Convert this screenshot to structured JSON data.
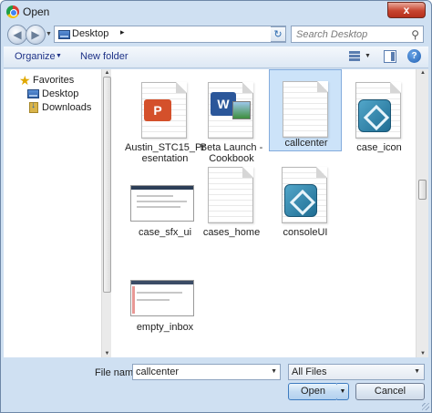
{
  "window": {
    "title": "Open",
    "close_label": "x"
  },
  "address": {
    "location": "Desktop",
    "separator": "▸"
  },
  "search": {
    "placeholder": "Search Desktop"
  },
  "toolbar": {
    "organize_label": "Organize",
    "new_folder_label": "New folder"
  },
  "navigation": {
    "items": [
      {
        "label": "Favorites",
        "icon": "star-icon"
      },
      {
        "label": "Desktop",
        "icon": "folder-icon"
      },
      {
        "label": "Downloads",
        "icon": "downloads-icon"
      }
    ]
  },
  "files": [
    {
      "name": "Austin_STC15_Presentation",
      "label_line1": "Austin_STC15_Pr",
      "label_line2": "esentation",
      "icon": "powerpoint-file-icon",
      "selected": false
    },
    {
      "name": "Beta Launch - Cookbook",
      "label_line1": "Beta Launch -",
      "label_line2": "Cookbook",
      "icon": "word-file-icon",
      "selected": false
    },
    {
      "name": "callcenter",
      "label_line1": "callcenter",
      "label_line2": "",
      "icon": "text-file-icon",
      "selected": true
    },
    {
      "name": "case_icon",
      "label_line1": "case_icon",
      "label_line2": "",
      "icon": "app-file-icon",
      "selected": false
    },
    {
      "name": "case_sfx_ui",
      "label_line1": "case_sfx_ui",
      "label_line2": "",
      "icon": "screenshot-thumbnail",
      "selected": false
    },
    {
      "name": "cases_home",
      "label_line1": "cases_home",
      "label_line2": "",
      "icon": "text-file-icon",
      "selected": false
    },
    {
      "name": "consoleUI",
      "label_line1": "consoleUI",
      "label_line2": "",
      "icon": "app-file-icon",
      "selected": false
    },
    {
      "name": "empty_inbox",
      "label_line1": "empty_inbox",
      "label_line2": "",
      "icon": "screenshot-thumbnail",
      "selected": false
    }
  ],
  "footer": {
    "file_name_label": "File name:",
    "file_name_value": "callcenter",
    "file_type_value": "All Files",
    "open_label": "Open",
    "cancel_label": "Cancel"
  },
  "colors": {
    "selection": "#cce3f9",
    "accent": "#1e3287",
    "frame": "#cfe0f2"
  }
}
